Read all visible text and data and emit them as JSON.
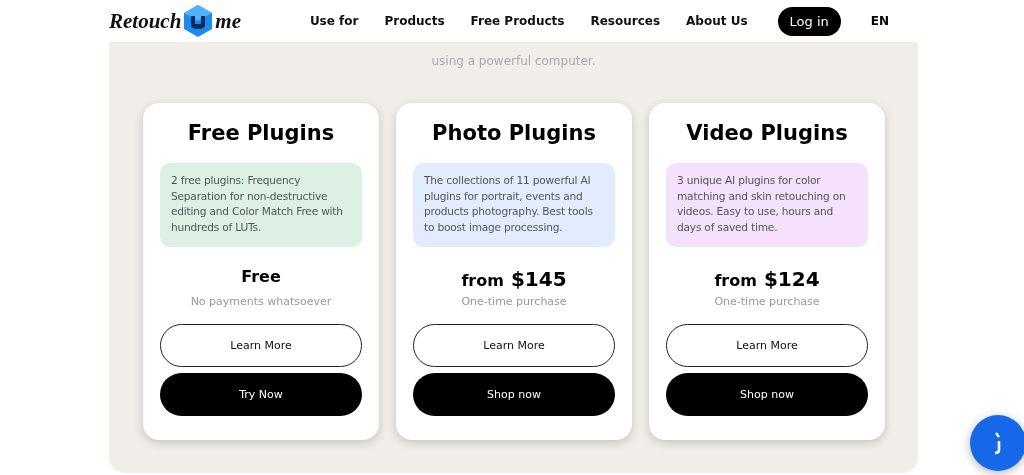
{
  "header": {
    "logo": {
      "left": "Retouch",
      "right": "me"
    },
    "nav": [
      {
        "label": "Use for"
      },
      {
        "label": "Products"
      },
      {
        "label": "Free Products"
      },
      {
        "label": "Resources"
      },
      {
        "label": "About Us"
      }
    ],
    "login": "Log in",
    "language": "EN"
  },
  "intro": "using a powerful computer.",
  "cards": [
    {
      "title": "Free Plugins",
      "description": "2 free plugins: Frequency Separation for non-destructive editing and Color Match Free with hundreds of LUTs.",
      "color": "#dcf1e3",
      "price": "Free",
      "note": "No payments whatsoever",
      "buttons": [
        "Learn More",
        "Try Now"
      ]
    },
    {
      "title": "Photo Plugins",
      "description": "The collections of 11 powerful AI plugins for portrait, events and products photography. Best tools to boost image processing.",
      "color": "#e3ecfd",
      "price_prefix": "from",
      "price": "$145",
      "note": "One-time purchase",
      "buttons": [
        "Learn More",
        "Shop now"
      ]
    },
    {
      "title": "Video Plugins",
      "description": "3 unique AI plugins for color matching and skin retouching on videos. Easy to use, hours and days of saved time.",
      "color": "#f5e1fb",
      "price_prefix": "from",
      "price": "$124",
      "note": "One-time purchase",
      "buttons": [
        "Learn More",
        "Shop now"
      ]
    }
  ]
}
